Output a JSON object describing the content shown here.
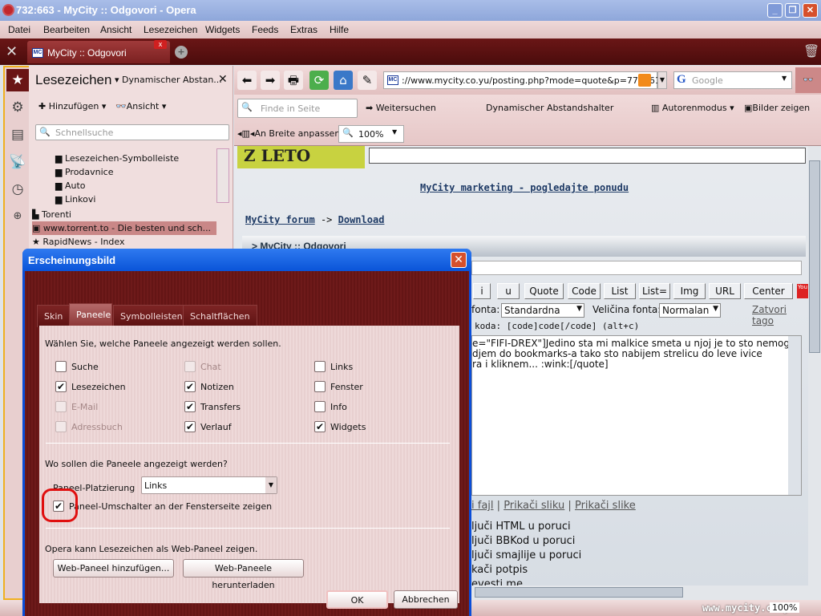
{
  "window": {
    "title": "732:663 - MyCity :: Odgovori - Opera"
  },
  "menu": [
    "Datei",
    "Bearbeiten",
    "Ansicht",
    "Lesezeichen",
    "Widgets",
    "Feeds",
    "Extras",
    "Hilfe"
  ],
  "tab": {
    "label": "MyCity :: Odgovori",
    "favicon": "MC"
  },
  "panel": {
    "title": "Lesezeichen",
    "dropdown": "Dynamischer Abstan...",
    "add": "Hinzufügen",
    "view": "Ansicht",
    "search_placeholder": "Schnellsuche",
    "folders": [
      "Lesezeichen-Symbolleiste",
      "Prodavnice",
      "Auto",
      "Linkovi"
    ],
    "items": [
      "Torenti",
      "www.torrent.to - Die besten und sch...",
      "RapidNews - Index"
    ]
  },
  "toolbar": {
    "url": "://www.mycity.co.yu/posting.php?mode=quote&p=773361",
    "search_placeholder": "Google",
    "find_placeholder": "Finde in Seite",
    "find_next": "Weitersuchen",
    "spacer": "Dynamischer Abstandshalter",
    "author_mode": "Autorenmodus",
    "show_images": "Bilder zeigen",
    "fit_width": "An Breite anpassen",
    "zoom": "100%"
  },
  "page": {
    "marketing": "MyCity marketing - pogledajte ponudu",
    "crumb1": "MyCity forum",
    "crumb_sep": "->",
    "crumb2": "Download",
    "section": "MyCity :: Odgovori",
    "bb_buttons": [
      "i",
      "u",
      "Quote",
      "Code",
      "List",
      "List=",
      "Img",
      "URL",
      "Center"
    ],
    "font_label": "fonta:",
    "font_value": "Standardna",
    "size_label": "Veličina fonta:",
    "size_value": "Normalan",
    "close_tags": "Zatvori tago",
    "code_hint": "koda: [code]code[/code]  (alt+c)",
    "textarea": [
      "e=\"FIFI-DREX\"]Jedino sta mi malkice smeta u njoj je to sto nemogu",
      "djem do bookmarks-a tako sto nabijem strelicu do leve ivice",
      "ra i kliknem... :wink:[/quote]"
    ],
    "attach1": "i fajl",
    "attach2": "Prikači sliku",
    "attach3": "Prikači slike",
    "attach_sep": "|",
    "options": [
      "ljuči HTML u poruci",
      "ljuči BBKod u poruci",
      "ljuči smajlije u poruci",
      "kači potpis",
      "evesti me"
    ]
  },
  "status": {
    "text": "www.mycity.co.yu",
    "zoom": "100%"
  },
  "dialog": {
    "title": "Erscheinungsbild",
    "tabs": [
      "Skin",
      "Paneele",
      "Symbolleisten",
      "Schaltflächen"
    ],
    "active_tab": "Paneele",
    "intro": "Wählen Sie, welche Paneele angezeigt werden sollen.",
    "checkboxes": [
      {
        "label": "Suche",
        "checked": false,
        "disabled": false
      },
      {
        "label": "Chat",
        "checked": false,
        "disabled": true
      },
      {
        "label": "Links",
        "checked": false,
        "disabled": false
      },
      {
        "label": "Lesezeichen",
        "checked": true,
        "disabled": false
      },
      {
        "label": "Notizen",
        "checked": true,
        "disabled": false
      },
      {
        "label": "Fenster",
        "checked": false,
        "disabled": false
      },
      {
        "label": "E-Mail",
        "checked": false,
        "disabled": true
      },
      {
        "label": "Transfers",
        "checked": true,
        "disabled": false
      },
      {
        "label": "Info",
        "checked": false,
        "disabled": false
      },
      {
        "label": "Adressbuch",
        "checked": false,
        "disabled": true
      },
      {
        "label": "Verlauf",
        "checked": true,
        "disabled": false
      },
      {
        "label": "Widgets",
        "checked": true,
        "disabled": false
      }
    ],
    "where": "Wo sollen die Paneele angezeigt werden?",
    "placement_label": "Paneel-Platzierung",
    "placement_value": "Links",
    "toggle_label": "Paneel-Umschalter an der Fensterseite zeigen",
    "toggle_checked": true,
    "web_intro": "Opera kann Lesezeichen als Web-Paneel zeigen.",
    "add_web": "Web-Paneel hinzufügen...",
    "download_web": "Web-Paneele herunterladen",
    "ok": "OK",
    "cancel": "Abbrechen"
  },
  "colors": {
    "skin": "#6b1a1a",
    "annotation": "#e01010",
    "xp_blue": "#0a54d8"
  }
}
